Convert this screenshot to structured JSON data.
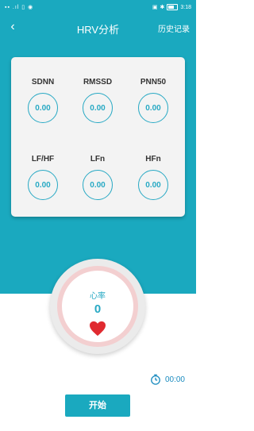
{
  "status_bar": {
    "time": "3:18"
  },
  "nav": {
    "back_icon": "chevron-left-icon",
    "title": "HRV分析",
    "history_label": "历史记录"
  },
  "metrics": [
    {
      "label": "SDNN",
      "value": "0.00"
    },
    {
      "label": "RMSSD",
      "value": "0.00"
    },
    {
      "label": "PNN50",
      "value": "0.00"
    },
    {
      "label": "LF/HF",
      "value": "0.00"
    },
    {
      "label": "LFn",
      "value": "0.00"
    },
    {
      "label": "HFn",
      "value": "0.00"
    }
  ],
  "heart_rate": {
    "label": "心率",
    "value": "0"
  },
  "timer": {
    "value": "00:00"
  },
  "start_button": {
    "label": "开始"
  },
  "colors": {
    "primary": "#1aa9bf",
    "accent_text": "#28a9c4",
    "heart": "#e02a30"
  }
}
